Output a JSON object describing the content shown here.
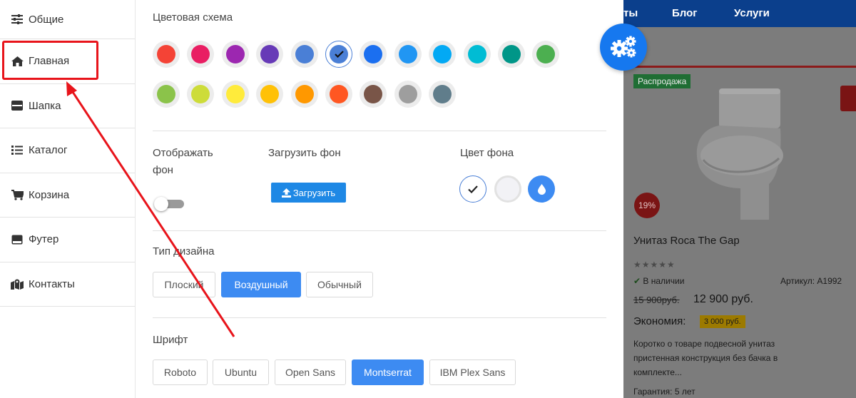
{
  "sidebar": {
    "items": [
      {
        "label": "Общие",
        "icon": "sliders-icon"
      },
      {
        "label": "Главная",
        "icon": "home-icon"
      },
      {
        "label": "Шапка",
        "icon": "header-icon"
      },
      {
        "label": "Каталог",
        "icon": "list-icon"
      },
      {
        "label": "Корзина",
        "icon": "cart-icon"
      },
      {
        "label": "Футер",
        "icon": "footer-icon"
      },
      {
        "label": "Контакты",
        "icon": "map-icon"
      }
    ]
  },
  "panel": {
    "color_scheme": {
      "title": "Цветовая схема",
      "colors": [
        "#f44336",
        "#e91e63",
        "#9c27b0",
        "#673ab7",
        "#4a7fd6",
        "#4a7fd6",
        "#1b6ff0",
        "#2196f3",
        "#03a9f4",
        "#00bcd4",
        "#009688",
        "#4caf50",
        "#8bc34a",
        "#cddc39",
        "#ffeb3b",
        "#ffc107",
        "#ff9800",
        "#ff5722",
        "#795548",
        "#9e9e9e",
        "#607d8b"
      ],
      "selected_index": 5
    },
    "show_bg": {
      "label": "Отображать фон",
      "enabled": false
    },
    "upload_bg": {
      "label": "Загрузить фон",
      "button": "Загрузить"
    },
    "bg_color": {
      "label": "Цвет фона",
      "selected_index": 0
    },
    "design_type": {
      "title": "Тип дизайна",
      "options": [
        "Плоский",
        "Воздушный",
        "Обычный"
      ],
      "selected": "Воздушный"
    },
    "font": {
      "title": "Шрифт",
      "options": [
        "Roboto",
        "Ubuntu",
        "Open Sans",
        "Montserrat",
        "IBM Plex Sans"
      ],
      "selected": "Montserrat"
    }
  },
  "preview": {
    "nav": [
      "ты",
      "Блог",
      "Услуги"
    ],
    "sale_badge": "Распродажа",
    "discount": "19%",
    "product_name": "Унитаз Roca The Gap",
    "stars": "★★★★★",
    "stock": "В наличии",
    "article": "Артикул: A1992",
    "old_price": "15 900руб.",
    "new_price": "12 900 руб.",
    "savings_label": "Экономия:",
    "savings_value": "3 000 руб.",
    "description": "Коротко о товаре подвесной унитаз пристенная конструкция без бачка в комплекте...",
    "guarantee": "Гарантия: 5 лет"
  },
  "colors": {
    "accent": "#3d8bf2",
    "annotation_red": "#e8141b",
    "gear_button": "#1678ef"
  }
}
